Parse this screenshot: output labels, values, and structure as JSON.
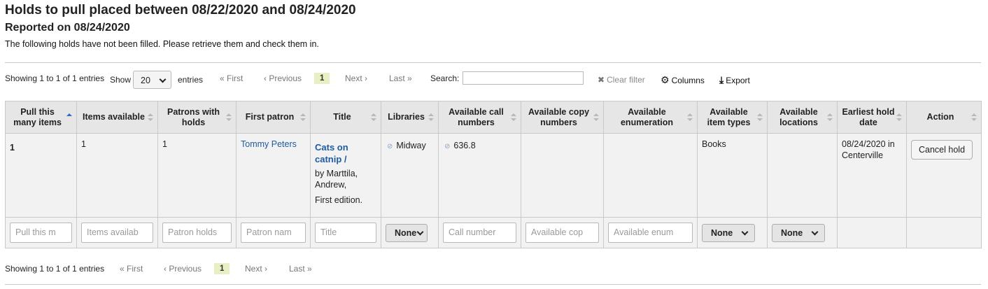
{
  "heading": {
    "title": "Holds to pull placed between 08/22/2020 and 08/24/2020",
    "reported": "Reported on 08/24/2020",
    "description": "The following holds have not been filled. Please retrieve them and check them in."
  },
  "toolbar": {
    "info": "Showing 1 to 1 of 1 entries",
    "show_label": "Show",
    "page_length": "20",
    "entries_label": "entries",
    "first": "« First",
    "previous": "‹ Previous",
    "current_page": "1",
    "next": "Next ›",
    "last": "Last »",
    "search_label": "Search:",
    "search_value": "",
    "clear_filter": "Clear filter",
    "columns": "Columns",
    "export": "Export"
  },
  "table": {
    "headers": [
      "Pull this many items",
      "Items available",
      "Patrons with holds",
      "First patron",
      "Title",
      "Libraries",
      "Available call numbers",
      "Available copy numbers",
      "Available enumeration",
      "Available item types",
      "Available locations",
      "Earliest hold date",
      "Action"
    ],
    "row": {
      "pull": "1",
      "items_available": "1",
      "patrons_with_holds": "1",
      "first_patron": "Tommy Peters",
      "title": "Cats on catnip /",
      "author": "by Marttila, Andrew,",
      "edition": "First edition.",
      "library": "Midway",
      "call_number": "636.8",
      "copy_numbers": "",
      "enumeration": "",
      "item_types": "Books",
      "locations": "",
      "hold_date": "08/24/2020 in Centerville",
      "action": "Cancel hold"
    },
    "filters": {
      "pull": "Pull this m",
      "items": "Items availab",
      "patrons": "Patron holds",
      "patron_name": "Patron nam",
      "title": "Title",
      "libraries": "None",
      "call_number": "Call number",
      "copy": "Available cop",
      "enum": "Available enum",
      "item_types": "None",
      "locations": "None"
    }
  },
  "bottom": {
    "info": "Showing 1 to 1 of 1 entries",
    "first": "« First",
    "previous": "‹ Previous",
    "current_page": "1",
    "next": "Next ›",
    "last": "Last »"
  }
}
